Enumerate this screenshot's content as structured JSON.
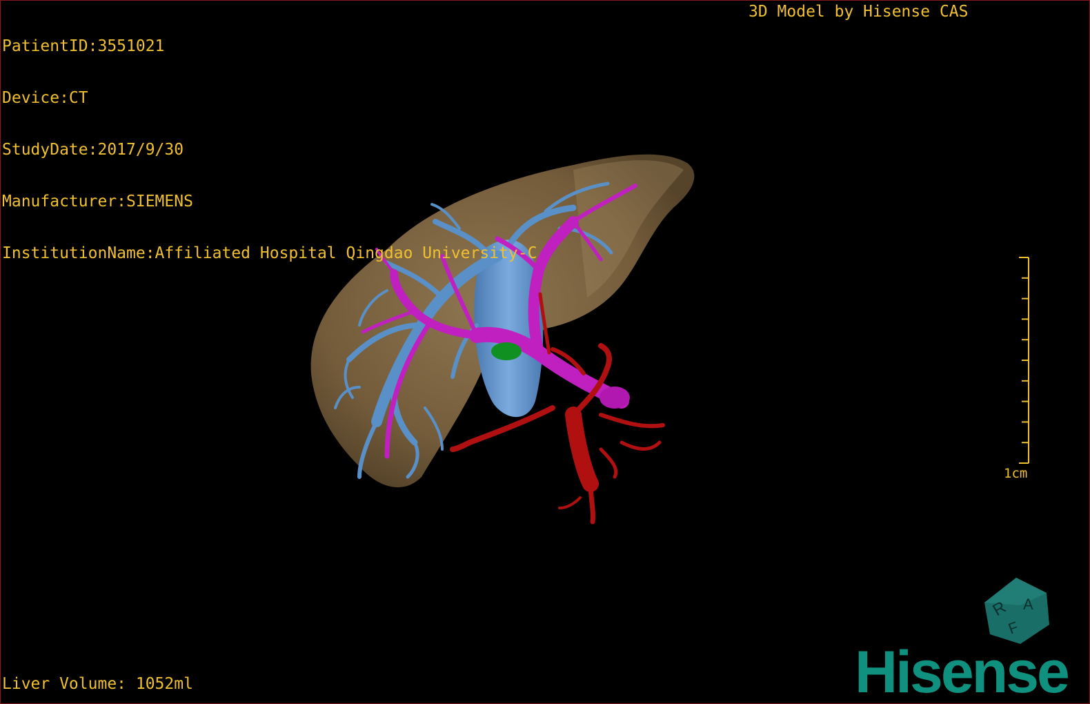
{
  "header": {
    "patient_id": "PatientID:3551021",
    "device": "Device:CT",
    "study_date": "StudyDate:2017/9/30",
    "manufacturer": "Manufacturer:SIEMENS",
    "institution": "InstitutionName:Affiliated Hospital Qingdao University-C"
  },
  "watermark_title": "3D Model by Hisense CAS",
  "footer": {
    "liver_volume": "Liver Volume: 1052ml"
  },
  "scale": {
    "label": "1cm",
    "tick_count": 11
  },
  "orientation_cube": {
    "labels": [
      "R",
      "A",
      "F"
    ],
    "color": "#1a6e68"
  },
  "brand": {
    "name": "Hisense",
    "color": "#10907e"
  },
  "colors": {
    "overlay_text": "#f0c030",
    "liver": "#8a7048",
    "hepatic_vein": "#5a90c8",
    "portal_vein": "#c020c0",
    "artery": "#b01010",
    "tumor": "#109020",
    "border": "#8a1a1a"
  }
}
